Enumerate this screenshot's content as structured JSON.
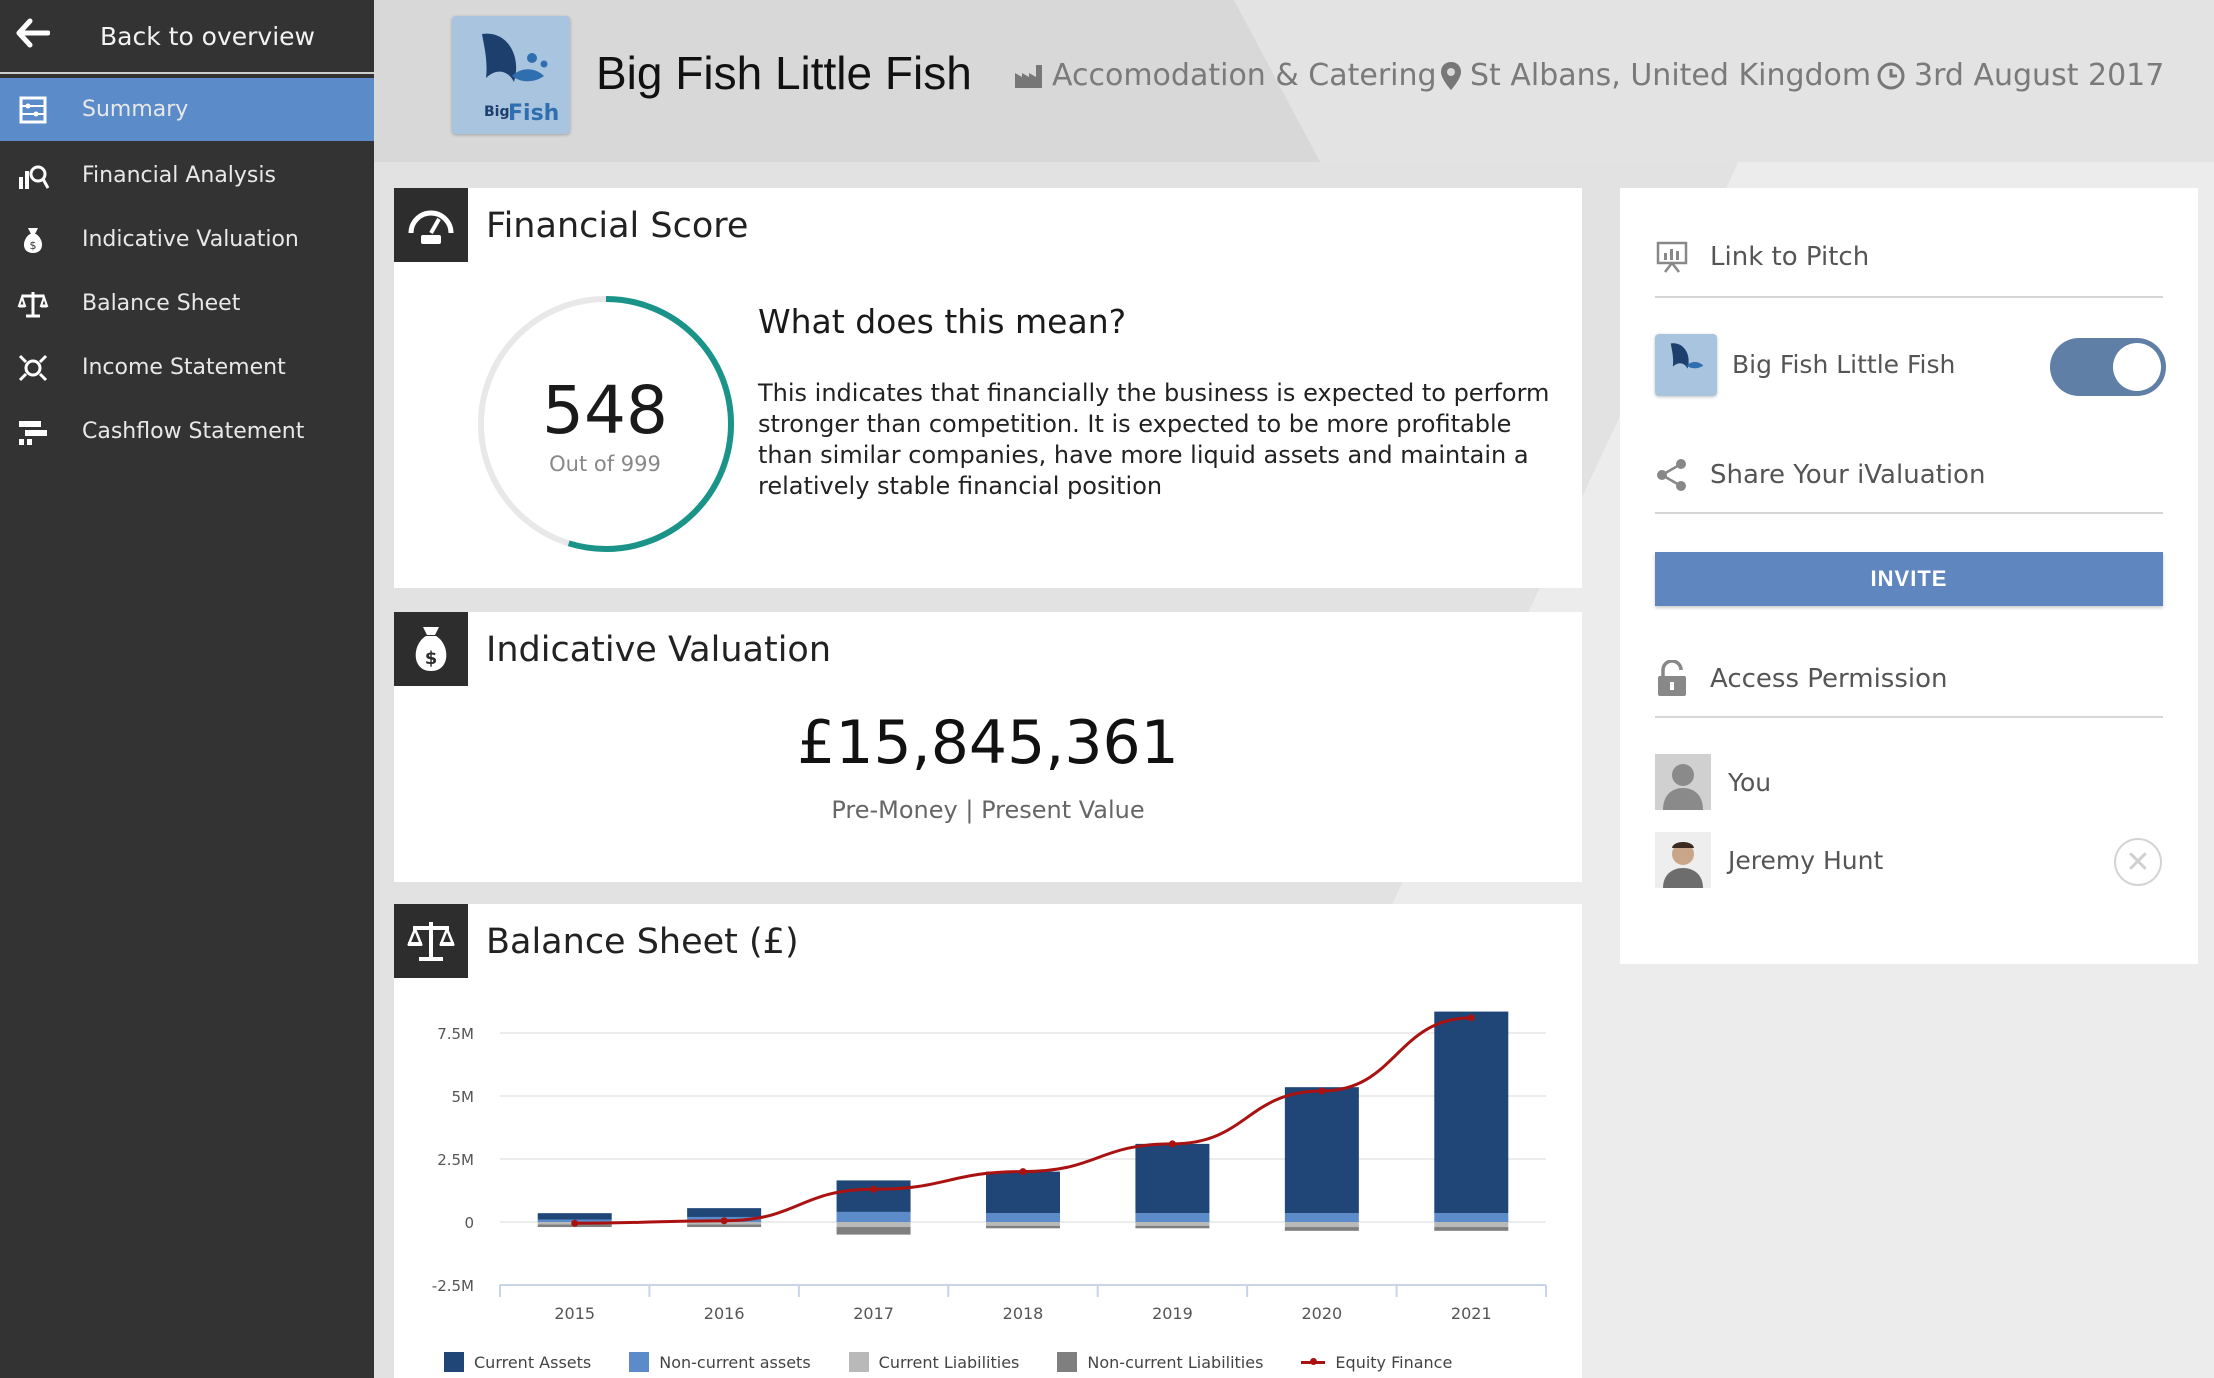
{
  "nav": {
    "back_label": "Back to overview",
    "items": [
      {
        "label": "Summary",
        "icon": "abacus-icon",
        "active": true
      },
      {
        "label": "Financial Analysis",
        "icon": "chart-magnify-icon"
      },
      {
        "label": "Indicative Valuation",
        "icon": "money-bag-icon"
      },
      {
        "label": "Balance Sheet",
        "icon": "scales-icon"
      },
      {
        "label": "Income Statement",
        "icon": "income-icon"
      },
      {
        "label": "Cashflow Statement",
        "icon": "cashflow-icon"
      }
    ]
  },
  "header": {
    "logo_text_top": "Big",
    "logo_text_bottom": "Fish",
    "company": "Big Fish Little Fish",
    "industry": "Accomodation & Catering",
    "location": "St Albans, United Kingdom",
    "date": "3rd August 2017"
  },
  "financial_score": {
    "title": "Financial Score",
    "score": "548",
    "out_of": "Out of 999",
    "score_fraction": 0.548,
    "meaning_title": "What does this mean?",
    "meaning_text": "This indicates that financially the business is expected to perform stronger than competition. It is expected to be more profitable than similar companies, have more liquid assets and maintain a relatively stable financial position"
  },
  "valuation": {
    "title": "Indicative Valuation",
    "amount": "£15,845,361",
    "subtitle": "Pre-Money | Present Value"
  },
  "balance_sheet": {
    "title": "Balance Sheet (£)"
  },
  "chart_data": {
    "type": "bar",
    "categories": [
      "2015",
      "2016",
      "2017",
      "2018",
      "2019",
      "2020",
      "2021"
    ],
    "y_tick_labels": [
      "7.5M",
      "5M",
      "2.5M",
      "0",
      "-2.5M"
    ],
    "y_ticks": [
      7500000,
      5000000,
      2500000,
      0,
      -2500000
    ],
    "ylim": [
      -2500000,
      8500000
    ],
    "series": [
      {
        "name": "Current Assets",
        "color": "#1f4677",
        "values": [
          250000,
          350000,
          1250000,
          1650000,
          2750000,
          5000000,
          8000000
        ]
      },
      {
        "name": "Non-current assets",
        "color": "#5b8bc9",
        "values": [
          100000,
          200000,
          400000,
          350000,
          350000,
          350000,
          350000
        ]
      },
      {
        "name": "Current Liabilities",
        "color": "#b9b9b9",
        "values": [
          -100000,
          -100000,
          -200000,
          -150000,
          -150000,
          -200000,
          -200000
        ]
      },
      {
        "name": "Non-current Liabilities",
        "color": "#7f7f7f",
        "values": [
          -100000,
          -100000,
          -300000,
          -100000,
          -100000,
          -150000,
          -150000
        ]
      },
      {
        "name": "Equity Finance",
        "color": "#aa1111",
        "type": "line",
        "values": [
          -50000,
          50000,
          1300000,
          2000000,
          3100000,
          5200000,
          8100000
        ]
      }
    ]
  },
  "right_panel": {
    "link_to_pitch": "Link to Pitch",
    "pitch_name": "Big Fish Little Fish",
    "pitch_toggle_on": true,
    "share_label": "Share Your iValuation",
    "invite_label": "INVITE",
    "access_label": "Access Permission",
    "people": [
      {
        "name": "You"
      },
      {
        "name": "Jeremy Hunt"
      }
    ],
    "remove_symbol": "✕"
  },
  "colors": {
    "accent": "#5b8bc9",
    "sidebar": "#333333",
    "score_ring": "#1a9488",
    "invite": "#5f86bf"
  }
}
